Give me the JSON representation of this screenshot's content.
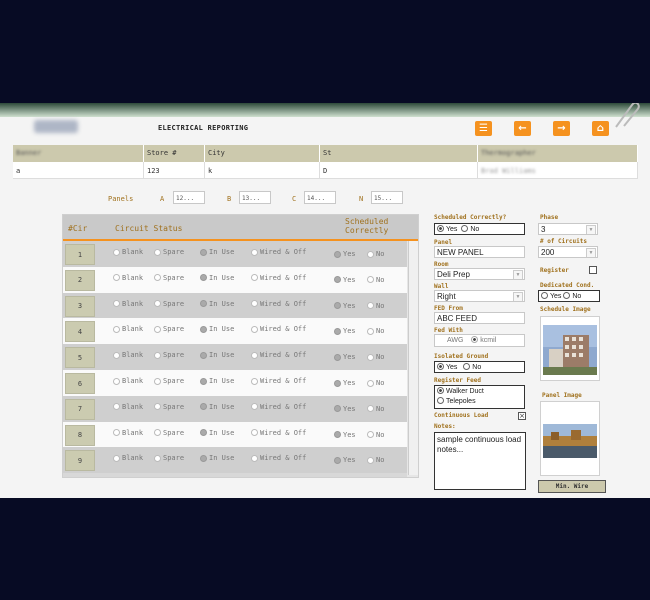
{
  "app": {
    "title": "ELECTRICAL REPORTING",
    "logo_text": "Ecotope"
  },
  "toolbar": [
    {
      "name": "list-menu-button",
      "icon": "list-icon",
      "glyph": "☰"
    },
    {
      "name": "back-button",
      "icon": "arrow-left-icon",
      "glyph": "←"
    },
    {
      "name": "forward-button",
      "icon": "arrow-right-icon",
      "glyph": "→"
    },
    {
      "name": "home-button",
      "icon": "home-icon",
      "glyph": "⌂"
    }
  ],
  "info": {
    "headers": [
      "Banner",
      "Store #",
      "City",
      "St",
      "Thermographer"
    ],
    "values": [
      "a",
      "123",
      "k",
      "D",
      "Brad Williams"
    ]
  },
  "panels": [
    {
      "label": "Panels",
      "value": ""
    },
    {
      "label": "A",
      "value": "12..."
    },
    {
      "label": "B",
      "value": "13..."
    },
    {
      "label": "C",
      "value": "14..."
    },
    {
      "label": "N",
      "value": "15..."
    }
  ],
  "circuits": {
    "headers": {
      "num": "#Cir",
      "status": "Circuit Status",
      "sched1": "Scheduled",
      "sched2": "Correctly"
    },
    "options": [
      "Blank",
      "Spare",
      "In Use",
      "Wired & Off"
    ],
    "yes": "Yes",
    "no": "No",
    "rows": [
      "1",
      "2",
      "3",
      "4",
      "5",
      "6",
      "7",
      "8",
      "9"
    ],
    "selected_status": "In Use",
    "selected_sched": "Yes"
  },
  "form": {
    "scheduled_correctly_label": "Scheduled Correctly?",
    "yes": "Yes",
    "no": "No",
    "panel_label": "Panel",
    "panel_value": "NEW PANEL",
    "room_label": "Room",
    "room_value": "Deli Prep",
    "wall_label": "Wall",
    "wall_value": "Right",
    "fed_from_label": "FED From",
    "fed_from_value": "ABC FEED",
    "fed_with_label": "Fed With",
    "awg": "AWG",
    "kcmil": "kcmil",
    "isolated_ground_label": "Isolated Ground",
    "register_feed_label": "Register Feed",
    "walker_duct": "Walker Duct",
    "telepoles": "Telepoles",
    "continuous_load_label": "Continuous Load",
    "notes_label": "Notes:",
    "notes_value": "sample continuous load notes...",
    "phase_label": "Phase",
    "phase_value": "3",
    "num_circuits_label": "# of Circuits",
    "num_circuits_value": "200",
    "register_label": "Register",
    "dedicated_cond_label": "Dedicated Cond.",
    "schedule_image_label": "Schedule Image",
    "panel_image_label": "Panel Image",
    "min_wire_label": "Min. Wire"
  },
  "colors": {
    "accent": "#f5921f",
    "header_bg": "#ccc9ad",
    "label": "#a0711d"
  }
}
